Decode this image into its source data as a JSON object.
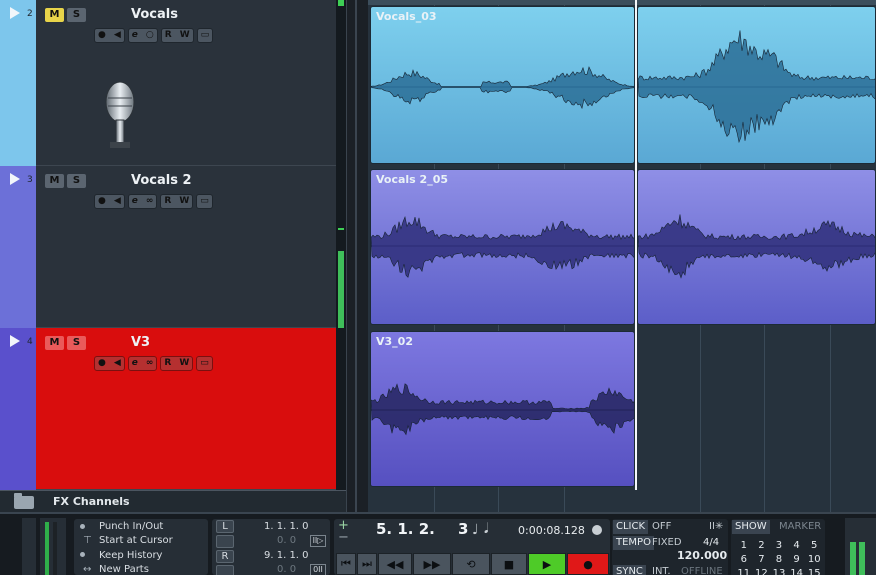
{
  "tracks": [
    {
      "number": "2",
      "name": "Vocals",
      "mute_label": "M",
      "solo_label": "S",
      "read_label": "R",
      "write_label": "W",
      "edit_label": "e",
      "color": "#7dc6ec",
      "body_color": "#2a323b",
      "mute_active": true,
      "has_icon": true,
      "icon": "microphone-icon"
    },
    {
      "number": "3",
      "name": "Vocals 2",
      "mute_label": "M",
      "solo_label": "S",
      "read_label": "R",
      "write_label": "W",
      "edit_label": "e",
      "color": "#6c70d8",
      "body_color": "#2a323b",
      "mute_active": false,
      "has_icon": false
    },
    {
      "number": "4",
      "name": "V3",
      "mute_label": "M",
      "solo_label": "S",
      "read_label": "R",
      "write_label": "W",
      "edit_label": "e",
      "color": "#5a50cc",
      "body_color": "#d90d0d",
      "mute_active": false,
      "has_icon": false
    }
  ],
  "clips": [
    {
      "name": "Vocals_03",
      "track": 0,
      "color_top": "#7ed0ee",
      "color_bottom": "#5aa8d4",
      "wave": "#2c6f97"
    },
    {
      "name": "",
      "track": 0,
      "color_top": "#7ed0ee",
      "color_bottom": "#5aa8d4",
      "wave": "#2c6f97"
    },
    {
      "name": "Vocals 2_05",
      "track": 1,
      "color_top": "#8f8fe6",
      "color_bottom": "#5c5ec8",
      "wave": "#2f2f7a"
    },
    {
      "name": "",
      "track": 1,
      "color_top": "#8f8fe6",
      "color_bottom": "#5c5ec8",
      "wave": "#2f2f7a"
    },
    {
      "name": "V3_02",
      "track": 2,
      "color_top": "#7d78e0",
      "color_bottom": "#5650c0",
      "wave": "#262660"
    }
  ],
  "fx_channels": {
    "label": "FX Channels"
  },
  "transport": {
    "punch": "Punch In/Out",
    "start_at_cursor": "Start at Cursor",
    "keep_history": "Keep History",
    "new_parts": "New Parts",
    "left_label": "L",
    "right_label": "R",
    "left_locator": "1. 1. 1.   0",
    "left_locator_sub": "0.    0",
    "right_locator": "9. 1. 1.   0",
    "right_locator_sub": "0.    0",
    "position_bars": "5.  1.  2.",
    "position_beat": "3",
    "time": "0:00:08.128",
    "click_label": "CLICK",
    "click_value": "OFF",
    "tempo_label": "TEMPO",
    "tempo_mode": "FIXED",
    "signature": "4/4",
    "tempo": "120.000",
    "sync_label": "SYNC",
    "sync_mode": "INT.",
    "sync_status": "OFFLINE",
    "show_label": "SHOW",
    "marker_label": "MARKER",
    "marker_numbers": [
      "1",
      "2",
      "3",
      "4",
      "5",
      "6",
      "7",
      "8",
      "9",
      "10",
      "11",
      "12",
      "13",
      "14",
      "15"
    ],
    "plus": "+",
    "minus": "−"
  },
  "colors": {
    "accent_yellow": "#e8d44a",
    "record_red": "#e01818",
    "play_green": "#4ecb28"
  }
}
